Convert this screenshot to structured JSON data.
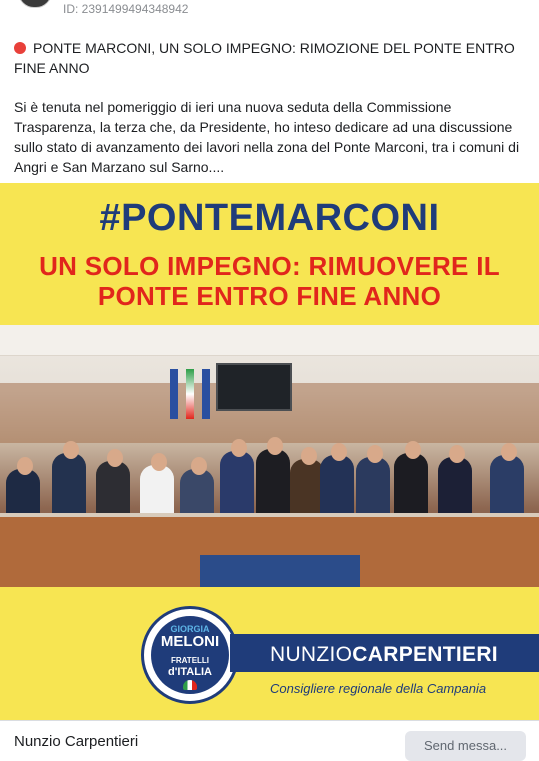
{
  "post": {
    "id_text": "ID: 2391499494348942",
    "headline": "PONTE MARCONI, UN SOLO IMPEGNO: RIMOZIONE DEL PONTE ENTRO FINE ANNO",
    "body": "Si è tenuta nel pomeriggio di ieri una nuova seduta della Commissione Trasparenza, la terza che, da Presidente, ho inteso dedicare ad una discussione sullo stato di avanzamento dei lavori nella zona del Ponte Marconi, tra i comuni di Angri e San Marzano sul Sarno...."
  },
  "ad_image": {
    "hashtag": "#PONTEMARCONI",
    "subtitle_line1": "UN SOLO IMPEGNO: RIMUOVERE IL",
    "subtitle_line2": "PONTE ENTRO FINE ANNO",
    "logo": {
      "giorgia": "GIORGIA",
      "meloni": "MELONI",
      "fratelli": "FRATELLI",
      "italia": "d'ITALIA"
    },
    "name_first": "NUNZIO",
    "name_last": "CARPENTIERI",
    "role": "Consigliere regionale della Campania",
    "colors": {
      "background": "#f7e552",
      "brand_blue": "#1f3c7a",
      "accent_red": "#e1261c"
    }
  },
  "footer": {
    "page_name": "Nunzio Carpentieri",
    "send_button": "Send messa..."
  }
}
